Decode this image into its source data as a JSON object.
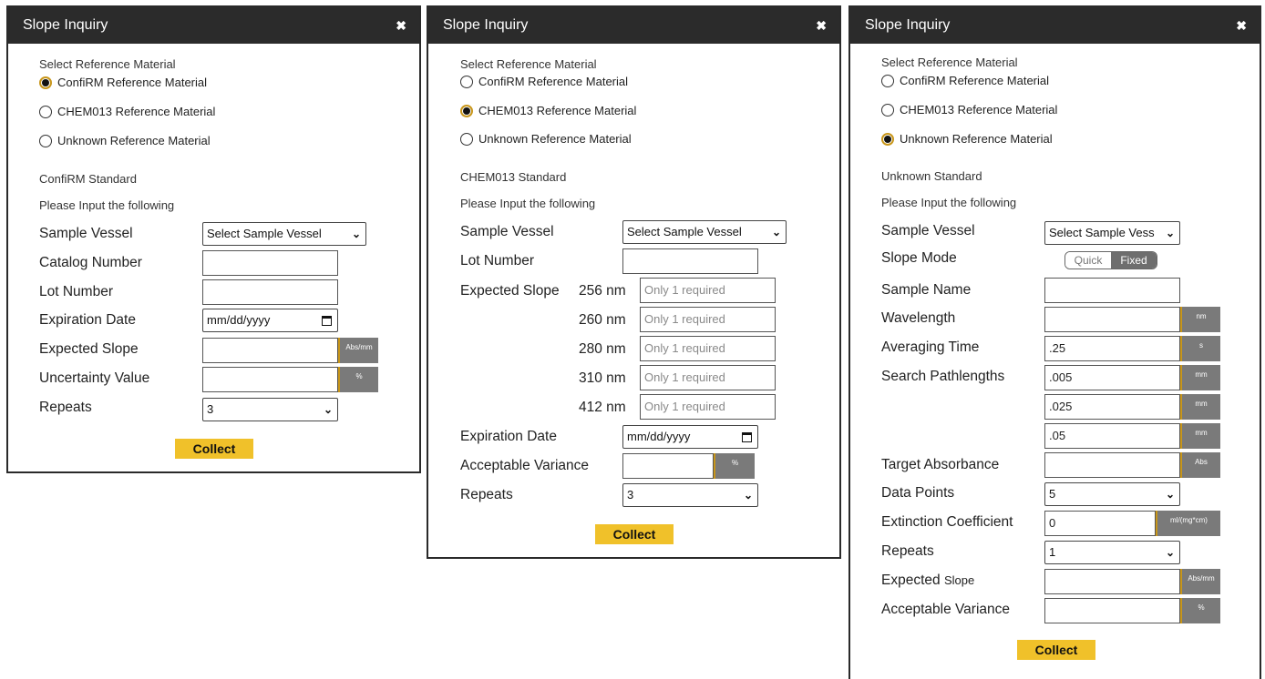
{
  "dialogs": [
    {
      "title": "Slope Inquiry",
      "close_label": "✖",
      "section_label": "Select Reference Material",
      "options": [
        "ConfiRM Reference Material",
        "CHEM013 Reference Material",
        "Unknown Reference Material"
      ],
      "selected": "ConfiRM Reference Material",
      "standard_label": "ConfiRM Standard",
      "prompt": "Please Input the following",
      "fields": {
        "sample_vessel": {
          "label": "Sample Vessel",
          "value": "Select Sample Vessel"
        },
        "catalog_number": {
          "label": "Catalog Number",
          "value": ""
        },
        "lot_number": {
          "label": "Lot Number",
          "value": ""
        },
        "expiration_date": {
          "label": "Expiration Date",
          "value": "mm/dd/yyyy"
        },
        "expected_slope": {
          "label": "Expected Slope",
          "value": "",
          "unit": "Abs/mm"
        },
        "uncertainty_value": {
          "label": "Uncertainty Value",
          "value": "",
          "unit": "%"
        },
        "repeats": {
          "label": "Repeats",
          "value": "3"
        }
      },
      "collect_label": "Collect"
    },
    {
      "title": "Slope Inquiry",
      "close_label": "✖",
      "section_label": "Select Reference Material",
      "options": [
        "ConfiRM Reference Material",
        "CHEM013 Reference Material",
        "Unknown Reference Material"
      ],
      "selected": "CHEM013 Reference Material",
      "standard_label": "CHEM013 Standard",
      "prompt": "Please Input the following",
      "fields": {
        "sample_vessel": {
          "label": "Sample Vessel",
          "value": "Select Sample Vessel"
        },
        "lot_number": {
          "label": "Lot Number",
          "value": ""
        },
        "expected_slope_label": "Expected Slope",
        "slope_wavelengths": [
          {
            "wavelength": "256 nm",
            "placeholder": "Only 1 required"
          },
          {
            "wavelength": "260 nm",
            "placeholder": "Only 1 required"
          },
          {
            "wavelength": "280 nm",
            "placeholder": "Only 1 required"
          },
          {
            "wavelength": "310 nm",
            "placeholder": "Only 1 required"
          },
          {
            "wavelength": "412 nm",
            "placeholder": "Only 1 required"
          }
        ],
        "expiration_date": {
          "label": "Expiration Date",
          "value": "mm/dd/yyyy"
        },
        "acceptable_variance": {
          "label": "Acceptable Variance",
          "value": "",
          "unit": "%"
        },
        "repeats": {
          "label": "Repeats",
          "value": "3"
        }
      },
      "collect_label": "Collect"
    },
    {
      "title": "Slope Inquiry",
      "close_label": "✖",
      "section_label": "Select Reference Material",
      "options": [
        "ConfiRM Reference Material",
        "CHEM013 Reference Material",
        "Unknown Reference Material"
      ],
      "selected": "Unknown Reference Material",
      "standard_label": "Unknown Standard",
      "prompt": "Please Input the following",
      "fields": {
        "sample_vessel": {
          "label": "Sample Vessel",
          "value": "Select Sample Vess"
        },
        "slope_mode": {
          "label": "Slope Mode",
          "options": [
            "Quick",
            "Fixed"
          ],
          "selected": "Fixed"
        },
        "sample_name": {
          "label": "Sample Name",
          "value": ""
        },
        "wavelength": {
          "label": "Wavelength",
          "value": "",
          "unit": "nm"
        },
        "averaging_time": {
          "label": "Averaging Time",
          "value": ".25",
          "unit": "s"
        },
        "search_pathlengths": {
          "label": "Search Pathlengths",
          "values": [
            ".005",
            ".025",
            ".05"
          ],
          "unit": "mm"
        },
        "target_absorbance": {
          "label": "Target Absorbance",
          "value": "",
          "unit": "Abs"
        },
        "data_points": {
          "label": "Data Points",
          "value": "5"
        },
        "extinction_coefficient": {
          "label": "Extinction Coefficient",
          "value": "0",
          "unit": "ml/(mg*cm)"
        },
        "repeats": {
          "label": "Repeats",
          "value": "1"
        },
        "expected_slope": {
          "label_main": "Expected",
          "label_small": "Slope",
          "value": "",
          "unit": "Abs/mm"
        },
        "acceptable_variance": {
          "label": "Acceptable Variance",
          "value": "",
          "unit": "%"
        }
      },
      "collect_label": "Collect"
    }
  ],
  "colors": {
    "titlebar": "#2b2b2b",
    "accent": "#f0c12a",
    "unit_box": "#7a7a7a"
  }
}
